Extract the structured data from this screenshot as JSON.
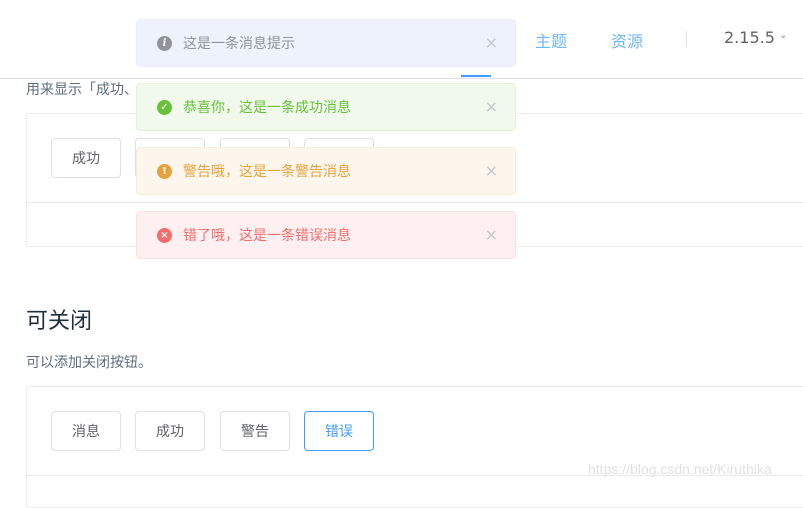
{
  "nav": {
    "theme": "主题",
    "resources": "资源",
    "version": "2.15.5"
  },
  "section1": {
    "description": "用来显示「成功、",
    "buttons": [
      "成功",
      "",
      "",
      ""
    ]
  },
  "section2": {
    "title": "可关闭",
    "description": "可以添加关闭按钮。",
    "buttons": [
      "消息",
      "成功",
      "警告",
      "错误"
    ]
  },
  "messages": [
    {
      "type": "info",
      "text": "这是一条消息提示"
    },
    {
      "type": "success",
      "text": "恭喜你，这是一条成功消息"
    },
    {
      "type": "warning",
      "text": "警告哦，这是一条警告消息"
    },
    {
      "type": "error",
      "text": "错了哦，这是一条错误消息"
    }
  ],
  "icons": {
    "info": "i",
    "success": "✓",
    "warning": "!",
    "error": "×",
    "close": "×",
    "chevron": "⌄"
  },
  "colors": {
    "primary": "#409eff",
    "info": "#909399",
    "success": "#67c23a",
    "warning": "#e6a23c",
    "error": "#f56c6c"
  },
  "watermark": "https://blog.csdn.net/Kiruthika"
}
